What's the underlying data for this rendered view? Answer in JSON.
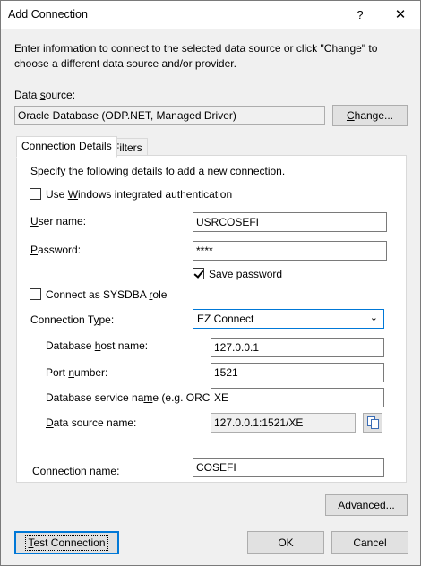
{
  "window": {
    "title": "Add Connection",
    "help_glyph": "?",
    "close_glyph": "✕"
  },
  "intro": "Enter information to connect to the selected data source or click \"Change\" to choose a different data source and/or provider.",
  "data_source": {
    "label_before": "Data ",
    "label_u": "s",
    "label_after": "ource:",
    "value": "Oracle Database (ODP.NET, Managed Driver)",
    "change_u": "C",
    "change_rest": "hange..."
  },
  "tabs": [
    {
      "label": "Connection Details",
      "active": true
    },
    {
      "label": "Filters",
      "active": false
    }
  ],
  "details": {
    "instruction": "Specify the following details to add a new connection.",
    "windows_auth": {
      "pre": "Use ",
      "u": "W",
      "post": "indows integrated authentication",
      "checked": false
    },
    "user_name": {
      "pre": "",
      "u": "U",
      "post": "ser name:",
      "value": "USRCOSEFI"
    },
    "password": {
      "pre": "",
      "u": "P",
      "post": "assword:",
      "value": "****"
    },
    "save_password": {
      "pre": "",
      "u": "S",
      "post": "ave password",
      "checked": true
    },
    "sysdba": {
      "pre": "Connect as SYSDBA ",
      "u": "r",
      "post": "ole",
      "checked": false
    },
    "connection_type": {
      "pre": "Connection T",
      "u": "y",
      "post": "pe:",
      "value": "EZ Connect"
    },
    "host": {
      "pre": "Database ",
      "u": "h",
      "post": "ost name:",
      "value": "127.0.0.1"
    },
    "port": {
      "pre": "Port ",
      "u": "n",
      "post": "umber:",
      "value": "1521"
    },
    "service": {
      "pre": "Database service na",
      "u": "m",
      "post": "e (e.g. ORCL):",
      "value": "XE"
    },
    "data_source_name": {
      "pre": "",
      "u": "D",
      "post": "ata source name:",
      "value": "127.0.0.1:1521/XE"
    },
    "connection_name": {
      "pre": "Co",
      "u": "n",
      "post": "nection name:",
      "value": "COSEFI"
    }
  },
  "buttons": {
    "advanced": {
      "pre": "Ad",
      "u": "v",
      "post": "anced..."
    },
    "test": {
      "pre": "",
      "u": "T",
      "post": "est Connection"
    },
    "ok": "OK",
    "cancel": "Cancel"
  }
}
